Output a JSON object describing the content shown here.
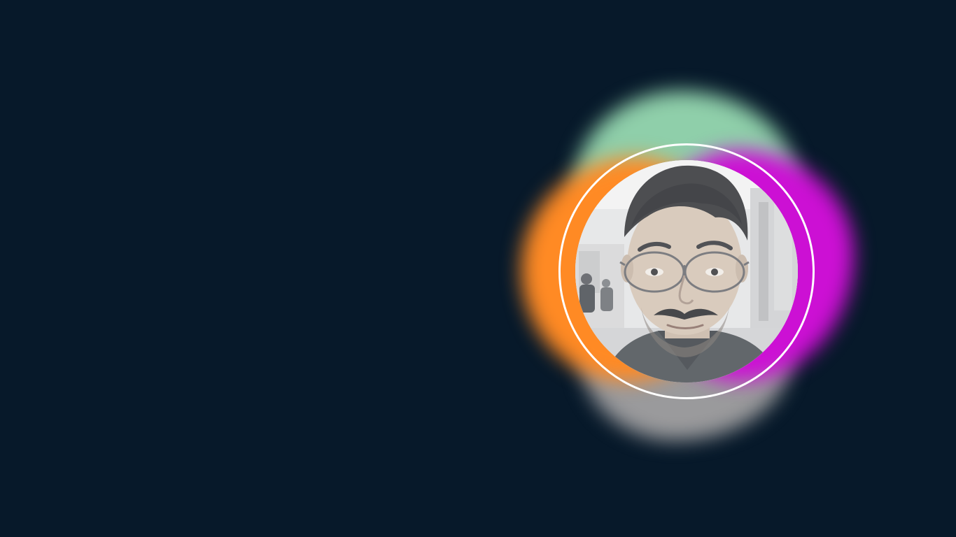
{
  "profile": {
    "avatar_alt": "Profile photo",
    "colors": {
      "background": "#07192a",
      "ring": "#ffffff",
      "blob_green": "#8fcfaa",
      "blob_orange": "#ff8a24",
      "blob_magenta": "#cc10d4",
      "blob_gray": "#9a9a9c"
    }
  }
}
